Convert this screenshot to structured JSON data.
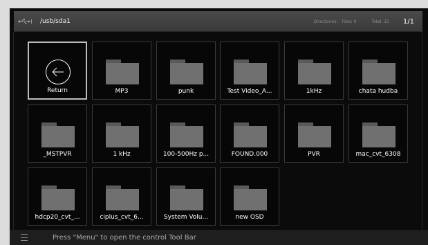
{
  "header": {
    "path": "/usb/sda1",
    "directories_label": "Directories:",
    "files_label": "Files: 0",
    "total_label": "Total: 15",
    "page": "1/1"
  },
  "tiles": [
    {
      "label": "Return",
      "icon": "return-arrow-icon"
    },
    {
      "label": "MP3",
      "icon": "folder-icon"
    },
    {
      "label": "punk",
      "icon": "folder-icon"
    },
    {
      "label": "Test Video_A...",
      "icon": "folder-icon"
    },
    {
      "label": "1kHz",
      "icon": "folder-icon"
    },
    {
      "label": "chata hudba",
      "icon": "folder-icon"
    },
    {
      "label": "_MSTPVR",
      "icon": "folder-icon"
    },
    {
      "label": "1 kHz",
      "icon": "folder-icon"
    },
    {
      "label": "100-500Hz p...",
      "icon": "folder-icon"
    },
    {
      "label": "FOUND.000",
      "icon": "folder-icon"
    },
    {
      "label": "PVR",
      "icon": "folder-icon"
    },
    {
      "label": "mac_cvt_6308",
      "icon": "folder-icon"
    },
    {
      "label": "hdcp20_cvt_...",
      "icon": "folder-icon"
    },
    {
      "label": "ciplus_cvt_6...",
      "icon": "folder-icon"
    },
    {
      "label": "System Volu...",
      "icon": "folder-icon"
    },
    {
      "label": "new OSD",
      "icon": "folder-icon"
    }
  ],
  "footer": {
    "hint": "Press \"Menu\" to open the control Tool Bar",
    "icon": "menu-icon"
  },
  "colors": {
    "background": "#0b0b0b",
    "header": "#404040",
    "folder": "#707070",
    "selection_border": "#bdbdbd"
  }
}
